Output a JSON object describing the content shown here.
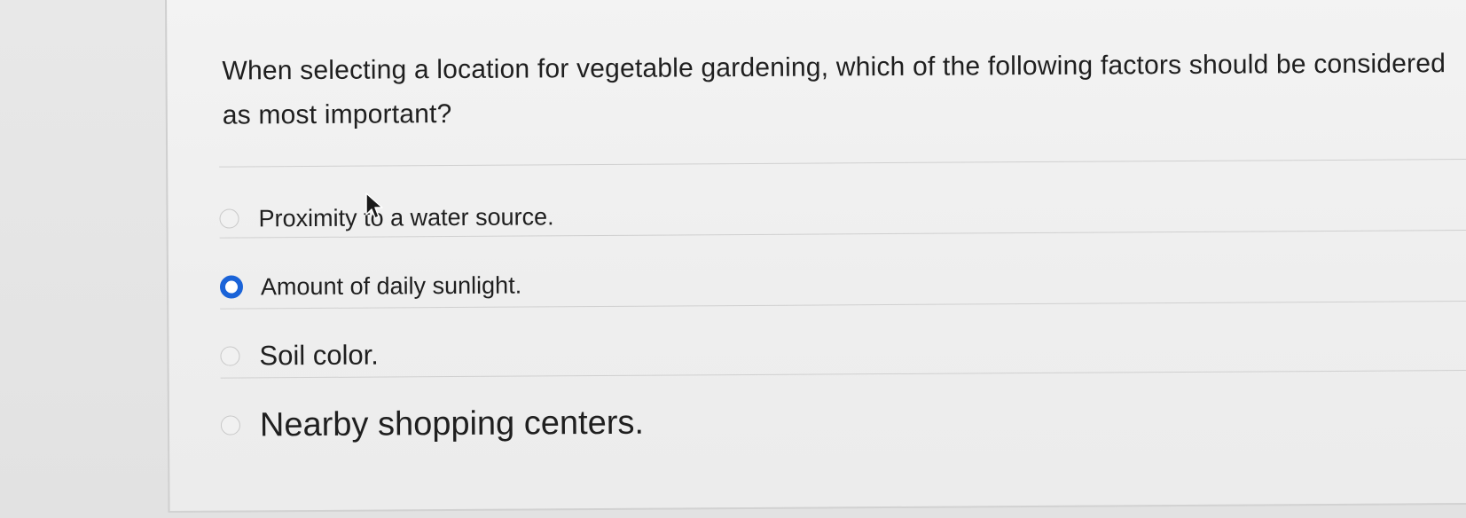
{
  "question": {
    "text": "When selecting a location for vegetable gardening, which of the following factors should be considered as most important?"
  },
  "options": [
    {
      "label": "Proximity to a water source.",
      "selected": false
    },
    {
      "label": "Amount of daily sunlight.",
      "selected": true
    },
    {
      "label": "Soil color.",
      "selected": false
    },
    {
      "label": "Nearby shopping centers.",
      "selected": false
    }
  ],
  "icons": {
    "radio_unselected": "radio-empty-icon",
    "radio_selected": "radio-filled-icon",
    "cursor": "mouse-pointer-icon"
  },
  "colors": {
    "accent": "#1a63d8",
    "text": "#1f1f1f",
    "background": "#efefef"
  }
}
